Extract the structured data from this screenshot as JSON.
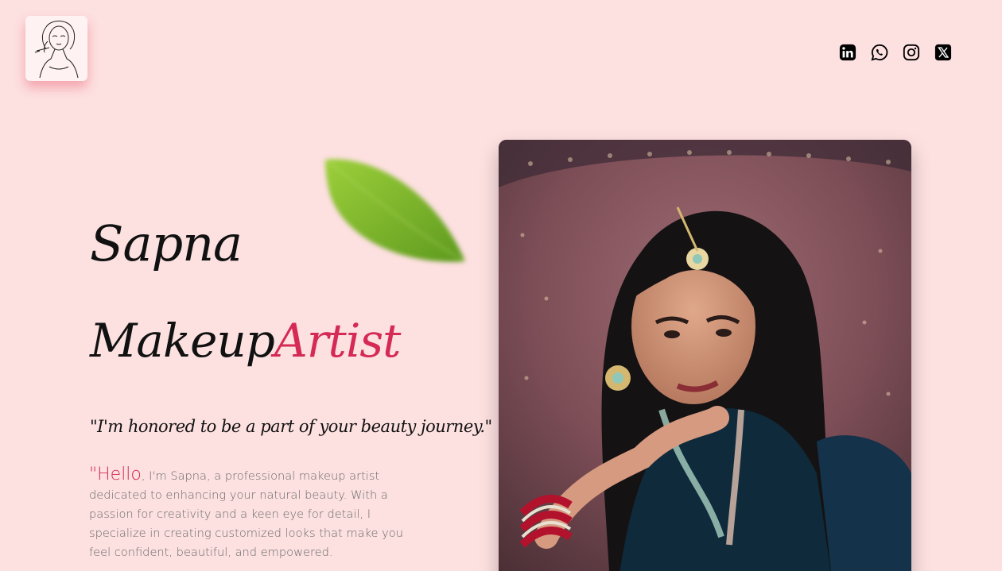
{
  "logo": {
    "alt": "makeup-artist-sketch-logo"
  },
  "social": [
    {
      "name": "linkedin",
      "icon": "linkedin-icon"
    },
    {
      "name": "whatsapp",
      "icon": "whatsapp-icon"
    },
    {
      "name": "instagram",
      "icon": "instagram-icon"
    },
    {
      "name": "x",
      "icon": "x-twitter-icon"
    }
  ],
  "hero": {
    "name": "Sapna",
    "title_main": "Makeup",
    "title_accent": "Artist",
    "quote": "\"I'm honored to be a part of your beauty journey.\"",
    "bio_hello": "\"Hello",
    "bio_text": ", I'm Sapna, a professional makeup artist dedicated to enhancing your natural beauty. With a passion for creativity and a keen eye for detail, I specialize in creating customized looks that make you feel confident, beautiful, and empowered."
  },
  "colors": {
    "background": "#fde0e0",
    "accent": "#d42a55",
    "text": "#111111",
    "body_text": "#6a6a6a"
  }
}
